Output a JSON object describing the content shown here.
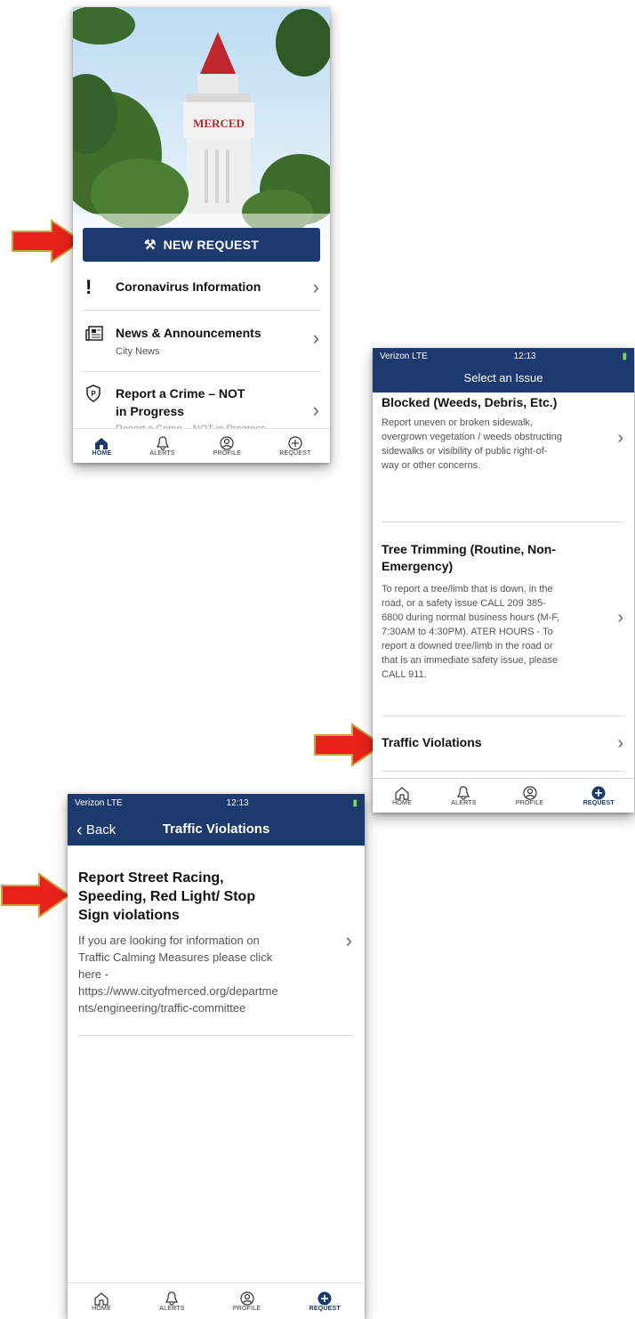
{
  "phone1": {
    "new_request_label": "NEW REQUEST",
    "rows": [
      {
        "title": "Coronavirus Information",
        "subtitle": ""
      },
      {
        "title": "News & Announcements",
        "subtitle": "City News"
      },
      {
        "title": "Report a Crime – NOT",
        "title2": "in Progress",
        "subtitle": "Report a Crime – NOT in Progress"
      }
    ],
    "tabs": [
      "HOME",
      "ALERTS",
      "PROFILE",
      "REQUEST"
    ]
  },
  "phone2": {
    "carrier": "Verizon  LTE",
    "time": "12:13",
    "header_title": "Select an Issue",
    "items": [
      {
        "title": "Blocked (Weeds, Debris, Etc.)",
        "desc": "Report uneven or broken sidewalk, overgrown vegetation / weeds obstructing sidewalks or visibility of public right-of-way or other concerns."
      },
      {
        "title": "Tree Trimming (Routine, Non-Emergency)",
        "desc": "To report a tree/limb that is down, in the road, or a safety issue CALL 209 385-6800 during normal business hours (M-F, 7:30AM to 4:30PM). ATER HOURS - To report a downed tree/limb in the road or that is an immediate safety issue, please CALL 911."
      },
      {
        "title": "Traffic Violations",
        "desc": ""
      }
    ],
    "tabs": [
      "HOME",
      "ALERTS",
      "PROFILE",
      "REQUEST"
    ]
  },
  "phone3": {
    "carrier": "Verizon  LTE",
    "time": "12:13",
    "back_label": "Back",
    "header_title": "Traffic Violations",
    "item_title": "Report Street Racing, Speeding, Red Light/ Stop Sign violations",
    "item_desc": "If you are looking for information on Traffic Calming Measures please click here - https://www.cityofmerced.org/departments/engineering/traffic-committee",
    "tabs": [
      "HOME",
      "ALERTS",
      "PROFILE",
      "REQUEST"
    ]
  },
  "colors": {
    "primary": "#1c3a6e",
    "arrow": "#e8221b"
  },
  "icons": [
    "exclamation-icon",
    "newspaper-icon",
    "police-badge-icon",
    "tools-icon",
    "home-icon",
    "bell-icon",
    "profile-icon",
    "plus-circle-icon",
    "chevron-right-icon",
    "chevron-left-icon"
  ]
}
